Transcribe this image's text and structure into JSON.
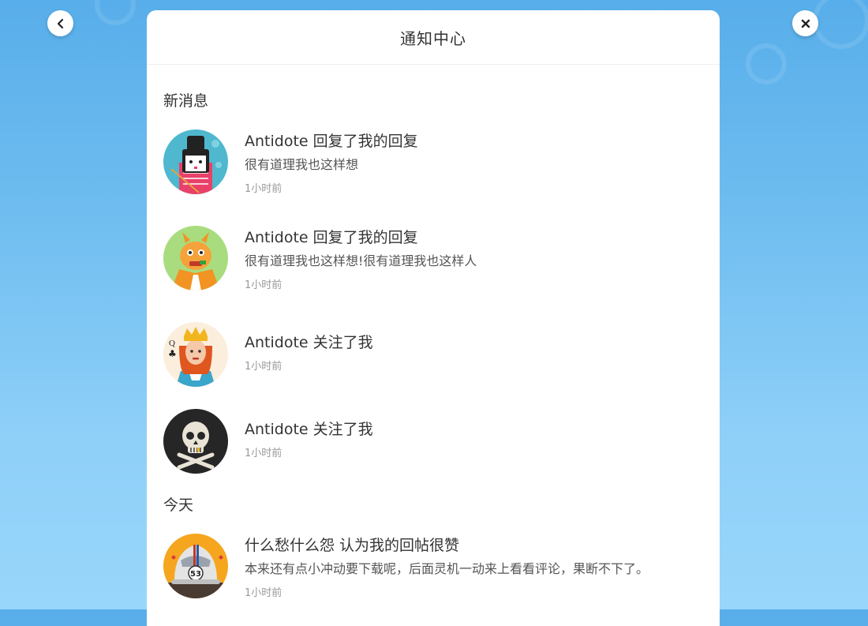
{
  "colors": {
    "accent": "#58aeea",
    "panel": "#ffffff",
    "text": "#333333",
    "muted": "#999999"
  },
  "nav": {
    "back_icon": "chevron-left-icon",
    "close_icon": "close-icon"
  },
  "header": {
    "title": "通知中心"
  },
  "sections": {
    "new": {
      "title": "新消息",
      "items": [
        {
          "title": "Antidote  回复了我的回复",
          "body": "很有道理我也这样想",
          "time": "1小时前",
          "avatar": "geisha-avatar"
        },
        {
          "title": "Antidote  回复了我的回复",
          "body": "很有道理我也这样想!很有道理我也这样人",
          "time": "1小时前",
          "avatar": "dragon-avatar"
        },
        {
          "title": "Antidote  关注了我",
          "time": "1小时前",
          "avatar": "queen-avatar"
        },
        {
          "title": "Antidote  关注了我",
          "time": "1小时前",
          "avatar": "skull-avatar"
        }
      ]
    },
    "today": {
      "title": "今天",
      "items": [
        {
          "title": "什么愁什么怨  认为我的回帖很赞",
          "body": "本来还有点小冲动要下载呢，后面灵机一动来上看看评论，果断不下了。",
          "time": "1小时前",
          "avatar": "car-avatar"
        }
      ]
    }
  }
}
